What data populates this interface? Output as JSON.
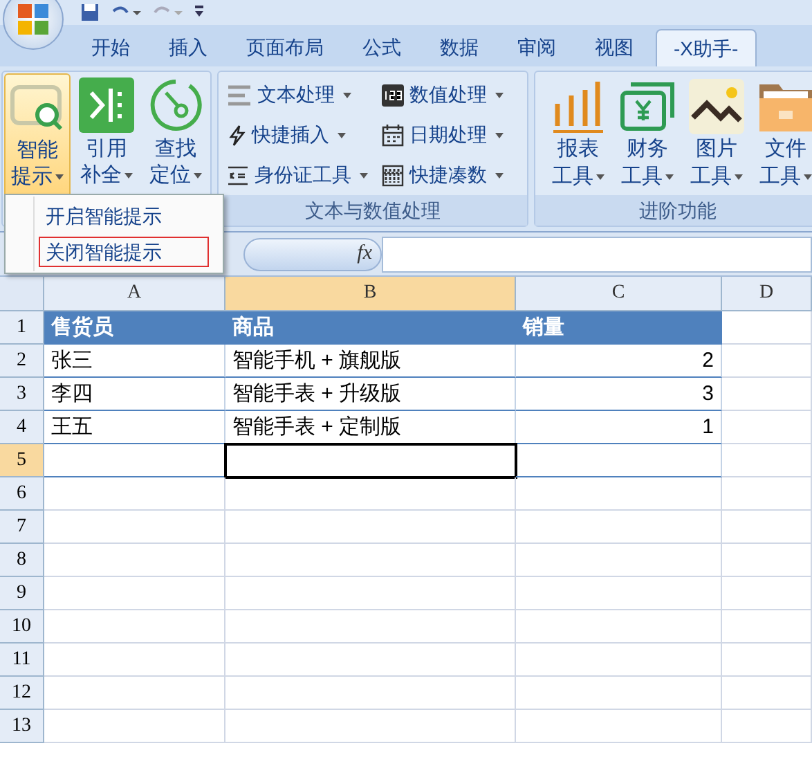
{
  "tabs": [
    {
      "label": "开始",
      "selected": false
    },
    {
      "label": "插入",
      "selected": false
    },
    {
      "label": "页面布局",
      "selected": false
    },
    {
      "label": "公式",
      "selected": false
    },
    {
      "label": "数据",
      "selected": false
    },
    {
      "label": "审阅",
      "selected": false
    },
    {
      "label": "视图",
      "selected": false
    },
    {
      "label": "-X助手-",
      "selected": true
    }
  ],
  "ribbon": {
    "large_buttons": [
      {
        "kind": "smart",
        "lines": [
          "智能",
          "提示"
        ],
        "pressed": true
      },
      {
        "kind": "cite",
        "lines": [
          "引用",
          "补全"
        ],
        "pressed": false
      },
      {
        "kind": "find",
        "lines": [
          "查找",
          "定位"
        ],
        "pressed": false
      }
    ],
    "text_group": {
      "items": [
        {
          "kind": "text",
          "label": "文本处理"
        },
        {
          "kind": "number",
          "label": "数值处理"
        },
        {
          "kind": "insert",
          "label": "快捷插入"
        },
        {
          "kind": "date",
          "label": "日期处理"
        },
        {
          "kind": "id",
          "label": "身份证工具"
        },
        {
          "kind": "sum",
          "label": "快捷凑数"
        }
      ],
      "label": "文本与数值处理"
    },
    "advanced_group": {
      "items": [
        {
          "kind": "chart",
          "lines": [
            "报表",
            "工具"
          ]
        },
        {
          "kind": "money",
          "lines": [
            "财务",
            "工具"
          ]
        },
        {
          "kind": "image",
          "lines": [
            "图片",
            "工具"
          ]
        },
        {
          "kind": "folder",
          "lines": [
            "文件",
            "工具"
          ]
        }
      ],
      "label": "进阶功能"
    }
  },
  "menu": {
    "items": [
      {
        "label": "开启智能提示",
        "outlined": false
      },
      {
        "label": "关闭智能提示",
        "outlined": true
      }
    ]
  },
  "formula_bar": {
    "fx": "fx"
  },
  "grid": {
    "columns": [
      {
        "label": "A",
        "selected": false
      },
      {
        "label": "B",
        "selected": true
      },
      {
        "label": "C",
        "selected": false
      },
      {
        "label": "D",
        "selected": false
      }
    ],
    "rows": [
      {
        "label": "1",
        "selected": false,
        "header": true,
        "cells": [
          "售货员",
          "商品",
          "销量"
        ]
      },
      {
        "label": "2",
        "selected": false,
        "header": false,
        "cells": [
          "张三",
          "智能手机 + 旗舰版",
          "2"
        ]
      },
      {
        "label": "3",
        "selected": false,
        "header": false,
        "cells": [
          "李四",
          "智能手表 + 升级版",
          "3"
        ]
      },
      {
        "label": "4",
        "selected": false,
        "header": false,
        "cells": [
          "王五",
          "智能手表 + 定制版",
          "1"
        ]
      },
      {
        "label": "5",
        "selected": true,
        "header": false,
        "cells": []
      },
      {
        "label": "6",
        "selected": false,
        "header": false,
        "cells": []
      },
      {
        "label": "7",
        "selected": false,
        "header": false,
        "cells": []
      },
      {
        "label": "8",
        "selected": false,
        "header": false,
        "cells": []
      },
      {
        "label": "9",
        "selected": false,
        "header": false,
        "cells": []
      },
      {
        "label": "10",
        "selected": false,
        "header": false,
        "cells": []
      },
      {
        "label": "11",
        "selected": false,
        "header": false,
        "cells": []
      },
      {
        "label": "12",
        "selected": false,
        "header": false,
        "cells": []
      },
      {
        "label": "13",
        "selected": false,
        "header": false,
        "cells": []
      }
    ]
  }
}
